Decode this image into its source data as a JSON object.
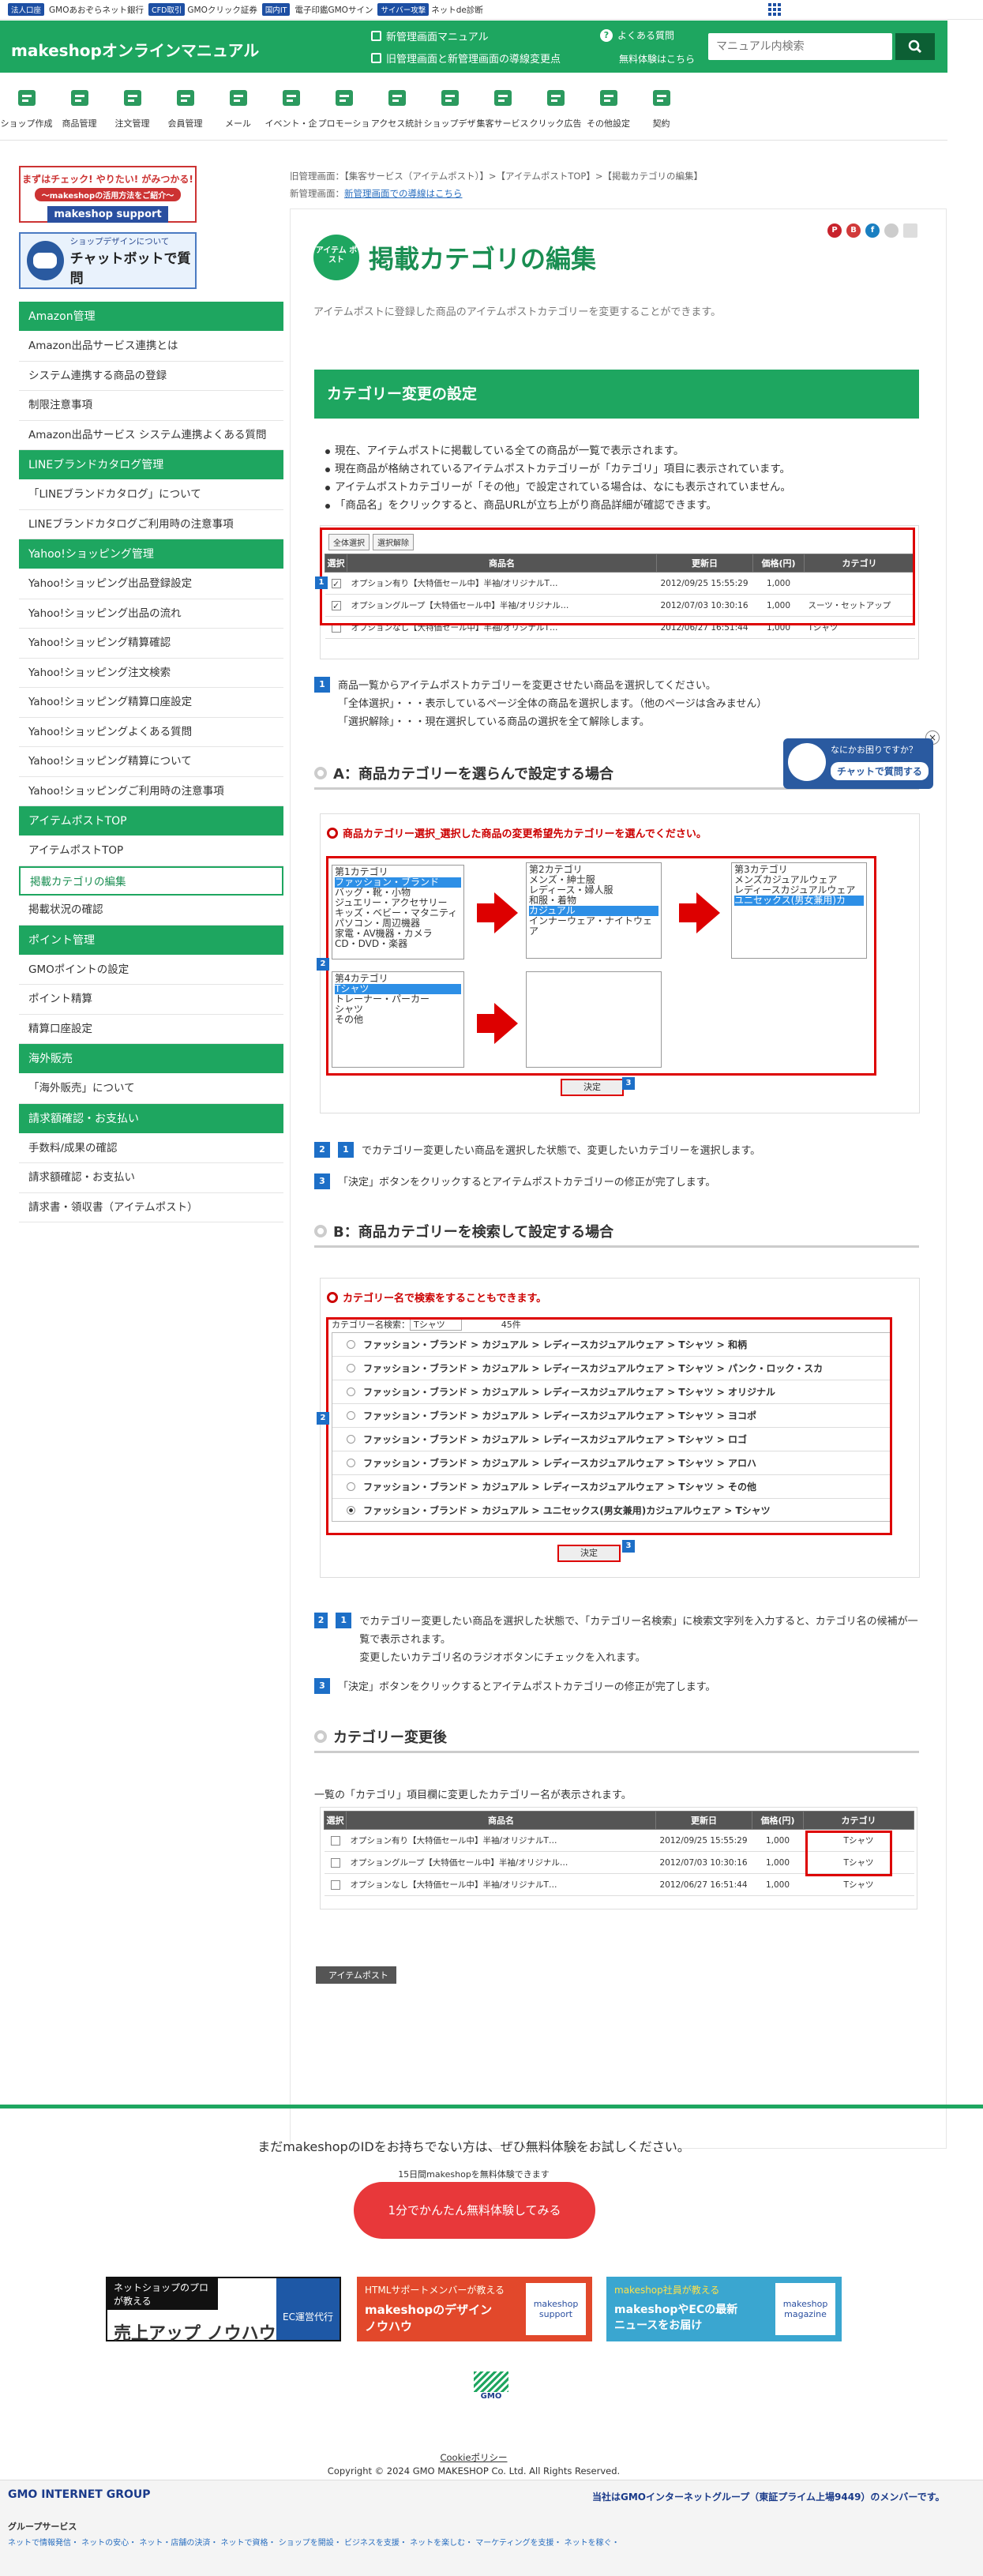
{
  "topbar": {
    "links": [
      {
        "badge": "法人口座",
        "text": ""
      },
      {
        "badge": "",
        "text": "GMOあおぞらネット銀行"
      },
      {
        "badge": "CFD取引",
        "text": "GMOクリック証券"
      },
      {
        "badge": "国内IT",
        "text": ""
      },
      {
        "badge": "",
        "text": "電子印鑑GMOサイン"
      },
      {
        "badge": "サイバー攻撃",
        "text": "ネットde診断"
      }
    ]
  },
  "header": {
    "logo": "makeshopオンラインマニュアル",
    "new_manual": "新管理画面マニュアル",
    "old_new": "旧管理画面と新管理画面の導線変更点",
    "help": "よくある質問",
    "trial": "無料体験はこちら",
    "search_placeholder": "マニュアル内検索"
  },
  "nav": [
    "ショップ作成",
    "商品管理",
    "注文管理",
    "会員管理",
    "メール",
    "イベント・企",
    "プロモーショ",
    "アクセス統計",
    "ショップデザ",
    "集客サービス",
    "クリック広告",
    "その他設定",
    "契約"
  ],
  "banners": {
    "b1_top": "まずはチェック! やりたい! がみつかる!",
    "b1_sub": "～makeshopの活用方法をご紹介～",
    "b1_logo": "makeshop support",
    "b2_t1": "ショップデザインについて",
    "b2_t2": "チャットボットで質問"
  },
  "menu": [
    {
      "type": "cat",
      "label": "Amazon管理"
    },
    {
      "type": "item",
      "label": "Amazon出品サービス連携とは"
    },
    {
      "type": "item",
      "label": "システム連携する商品の登録"
    },
    {
      "type": "item",
      "label": "制限注意事項"
    },
    {
      "type": "item",
      "label": "Amazon出品サービス システム連携よくある質問"
    },
    {
      "type": "cat",
      "label": "LINEブランドカタログ管理"
    },
    {
      "type": "item",
      "label": "「LINEブランドカタログ」について"
    },
    {
      "type": "item",
      "label": "LINEブランドカタログご利用時の注意事項"
    },
    {
      "type": "cat",
      "label": "Yahoo!ショッピング管理"
    },
    {
      "type": "item",
      "label": "Yahoo!ショッピング出品登録設定"
    },
    {
      "type": "item",
      "label": "Yahoo!ショッピング出品の流れ"
    },
    {
      "type": "item",
      "label": "Yahoo!ショッピング精算確認"
    },
    {
      "type": "item",
      "label": "Yahoo!ショッピング注文検索"
    },
    {
      "type": "item",
      "label": "Yahoo!ショッピング精算口座設定"
    },
    {
      "type": "item",
      "label": "Yahoo!ショッピングよくある質問"
    },
    {
      "type": "item",
      "label": "Yahoo!ショッピング精算について"
    },
    {
      "type": "item",
      "label": "Yahoo!ショッピングご利用時の注意事項"
    },
    {
      "type": "cat",
      "label": "アイテムポストTOP"
    },
    {
      "type": "item",
      "label": "アイテムポストTOP"
    },
    {
      "type": "item",
      "label": "掲載カテゴリの編集",
      "active": true
    },
    {
      "type": "item",
      "label": "掲載状況の確認"
    },
    {
      "type": "cat",
      "label": "ポイント管理"
    },
    {
      "type": "item",
      "label": "GMOポイントの設定"
    },
    {
      "type": "item",
      "label": "ポイント精算"
    },
    {
      "type": "item",
      "label": "精算口座設定"
    },
    {
      "type": "cat",
      "label": "海外販売"
    },
    {
      "type": "item",
      "label": "「海外販売」について"
    },
    {
      "type": "cat",
      "label": "請求額確認・お支払い"
    },
    {
      "type": "item",
      "label": "手数料/成果の確認"
    },
    {
      "type": "item",
      "label": "請求額確認・お支払い"
    },
    {
      "type": "item",
      "label": "請求書・領収書（アイテムポスト）"
    }
  ],
  "breadcrumb": {
    "path": "旧管理画面：【集客サービス（アイテムポスト）】>【アイテムポストTOP】>【掲載カテゴリの編集】",
    "new_prefix": "新管理画面：",
    "new_link": "新管理画面での導線はこちら"
  },
  "page": {
    "logo_text": "アイテム ポスト",
    "title": "掲載カテゴリの編集",
    "desc": "アイテムポストに登録した商品のアイテムポストカテゴリーを変更することができます。"
  },
  "section1": {
    "heading": "カテゴリー変更の設定",
    "bullets": [
      "現在、アイテムポストに掲載している全ての商品が一覧で表示されます。",
      "現在商品が格納されているアイテムポストカテゴリーが「カテゴリ」項目に表示されています。",
      "アイテムポストカテゴリーが「その他」で設定されている場合は、なにも表示されていません。",
      "「商品名」をクリックすると、商品URLが立ち上がり商品詳細が確認できます。"
    ]
  },
  "table": {
    "btn_all": "全体選択",
    "btn_clear": "選択解除",
    "headers": [
      "選択",
      "商品名",
      "更新日",
      "価格(円)",
      "カテゴリ"
    ],
    "rows": [
      [
        "オプション有り【大特価セール中】半袖/オリジナルT…",
        "2012/09/25 15:55:29",
        "1,000",
        ""
      ],
      [
        "オプショングループ【大特価セール中】半袖/オリジナル…",
        "2012/07/03 10:30:16",
        "1,000",
        "スーツ・セットアップ"
      ],
      [
        "オプションなし【大特価セール中】半袖/オリジナルT…",
        "2012/06/27 16:51:44",
        "1,000",
        "Tシャツ"
      ]
    ]
  },
  "step1": {
    "num": "1",
    "lines": [
      "商品一覧からアイテムポストカテゴリーを変更させたい商品を選択してください。",
      "「全体選択」・・・表示しているページ全体の商品を選択します。（他のページは含みません）",
      "「選択解除」・・・現在選択している商品の選択を全て解除します。"
    ]
  },
  "sectionA": {
    "heading": "A：商品カテゴリーを選らんで設定する場合",
    "label": "商品カテゴリー選択_選択した商品の変更希望先カテゴリーを選んでください。",
    "cat1": [
      "第1カテゴリ",
      "ファッション・ブランド",
      "バッグ・靴・小物",
      "ジュエリー・アクセサリー",
      "キッズ・ベビー・マタニティ",
      "パソコン・周辺機器",
      "家電・AV機器・カメラ",
      "CD・DVD・楽器"
    ],
    "cat2": [
      "第2カテゴリ",
      "メンズ・紳士服",
      "レディース・婦人服",
      "和服・着物",
      "カジュアル",
      "インナーウェア・ナイトウェア"
    ],
    "cat3": [
      "第3カテゴリ",
      "メンズカジュアルウェア",
      "レディースカジュアルウェア",
      "ユニセックス(男女兼用)カ"
    ],
    "cat4": [
      "第4カテゴリ",
      "Tシャツ",
      "トレーナー・パーカー",
      "シャツ",
      "その他"
    ],
    "decide": "決定",
    "steps": [
      {
        "n": "2",
        "inner": "1",
        "text": "でカテゴリー変更したい商品を選択した状態で、変更したいカテゴリーを選択します。"
      },
      {
        "n": "3",
        "text": "「決定」ボタンをクリックするとアイテムポストカテゴリーの修正が完了します。"
      }
    ]
  },
  "sectionB": {
    "heading": "B：商品カテゴリーを検索して設定する場合",
    "label": "カテゴリー名で検索をすることもできます。",
    "search_label": "カテゴリー名検索：",
    "search_value": "Tシャツ",
    "count": "45件",
    "rows": [
      "ファッション・ブランド > カジュアル > レディースカジュアルウェア > Tシャツ > 和柄",
      "ファッション・ブランド > カジュアル > レディースカジュアルウェア > Tシャツ > パンク・ロック・スカ",
      "ファッション・ブランド > カジュアル > レディースカジュアルウェア > Tシャツ > オリジナル",
      "ファッション・ブランド > カジュアル > レディースカジュアルウェア > Tシャツ > ヨコポ",
      "ファッション・ブランド > カジュアル > レディースカジュアルウェア > Tシャツ > ロゴ",
      "ファッション・ブランド > カジュアル > レディースカジュアルウェア > Tシャツ > アロハ",
      "ファッション・ブランド > カジュアル > レディースカジュアルウェア > Tシャツ > その他",
      "ファッション・ブランド > カジュアル > ユニセックス(男女兼用)カジュアルウェア > Tシャツ"
    ],
    "decide": "決定",
    "steps": [
      {
        "n": "2",
        "inner": "1",
        "text": "でカテゴリー変更したい商品を選択した状態で、「カテゴリー名検索」に検索文字列を入力すると、カテゴリ名の候補が一覧で表示されます。",
        "text2": "変更したいカテゴリ名のラジオボタンにチェックを入れます。"
      },
      {
        "n": "3",
        "text": "「決定」ボタンをクリックするとアイテムポストカテゴリーの修正が完了します。"
      }
    ]
  },
  "sectionAfter": {
    "heading": "カテゴリー変更後",
    "desc": "一覧の「カテゴリ」項目欄に変更したカテゴリー名が表示されます。",
    "rows": [
      [
        "オプション有り【大特価セール中】半袖/オリジナルT…",
        "2012/09/25 15:55:29",
        "1,000",
        "Tシャツ"
      ],
      [
        "オプショングループ【大特価セール中】半袖/オリジナル…",
        "2012/07/03 10:30:16",
        "1,000",
        "Tシャツ"
      ],
      [
        "オプションなし【大特価セール中】半袖/オリジナルT…",
        "2012/06/27 16:51:44",
        "1,000",
        "Tシャツ"
      ]
    ]
  },
  "tag": "アイテムポスト",
  "chat_widget": {
    "t1": "なにかお困りですか？",
    "t2": "チャットで質問する"
  },
  "footer": {
    "cta_text": "まだmakeshopのIDをお持ちでない方は、ぜひ無料体験をお試しください。",
    "cta_sub": "15日間makeshopを無料体験できます",
    "cta_btn": "1分でかんたん無料体験してみる",
    "ban1_top": "ネットショップのプロが教える",
    "ban1_main": "売上アップ ノウハウ",
    "ban1_right": "EC運営代行",
    "ban2_top": "HTMLサポートメンバーが教える",
    "ban2_main": "makeshopのデザインノウハウ",
    "ban2_right": "makeshop support",
    "ban3_top": "makeshop社員が教える",
    "ban3_main": "makeshopやECの最新ニュースをお届け",
    "ban3_right": "makeshop magazine",
    "gmo": "GMO",
    "policy": "Cookieポリシー",
    "copyright": "Copyright © 2024 GMO MAKESHOP Co. Ltd. All Rights Reserved.",
    "group": "GMO INTERNET GROUP",
    "member": "当社はGMOインターネットグループ（東証プライム上場9449）のメンバーです。",
    "group_services": "グループサービス",
    "group_links": "ネットで情報発信・ ネットの安心・ ネット・店舗の決済・ ネットで資格・ ショップを開設・ ビジネスを支援・ ネットを楽しむ・ マーケティングを支援・ ネットを稼ぐ・"
  },
  "colors": {
    "brand_green": "#1ea660",
    "red": "#e8383a",
    "step_blue": "#1d6fc7"
  }
}
